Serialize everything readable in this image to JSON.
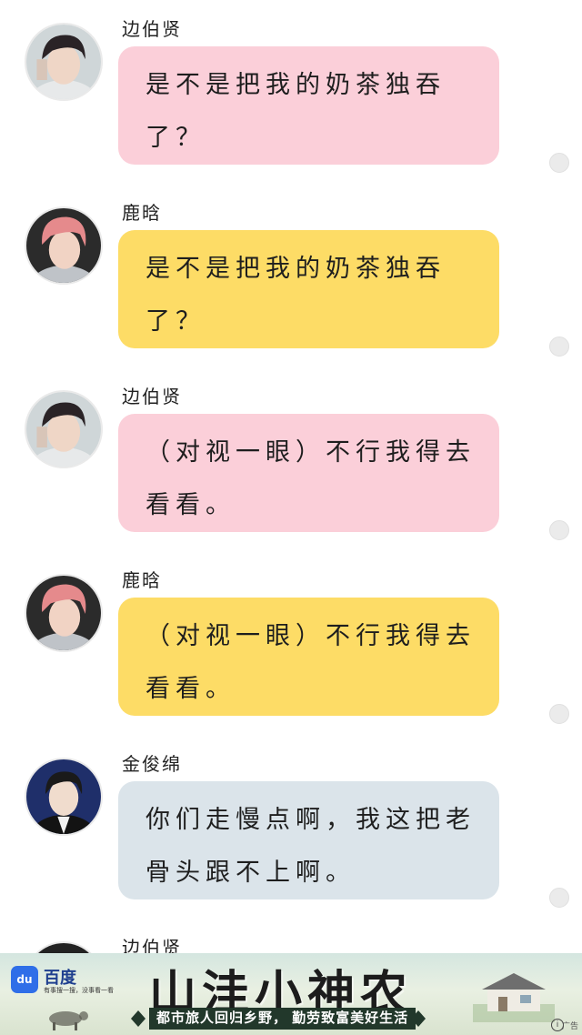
{
  "messages": [
    {
      "sender": "边伯贤",
      "text": "是不是把我的奶茶独吞了？",
      "bubble_color": "#fbcfd9",
      "avatar": "boy-dark-hair-avatar"
    },
    {
      "sender": "鹿晗",
      "text": "是不是把我的奶茶独吞了？",
      "bubble_color": "#fddc66",
      "avatar": "boy-pink-hair-avatar"
    },
    {
      "sender": "边伯贤",
      "text": "（对视一眼）不行我得去看看。",
      "bubble_color": "#fbcfd9",
      "avatar": "boy-dark-hair-avatar"
    },
    {
      "sender": "鹿晗",
      "text": "（对视一眼）不行我得去看看。",
      "bubble_color": "#fddc66",
      "avatar": "boy-pink-hair-avatar"
    },
    {
      "sender": "金俊绵",
      "text": "你们走慢点啊，我这把老骨头跟不上啊。",
      "bubble_color": "#dbe4ea",
      "avatar": "boy-suit-avatar"
    },
    {
      "sender": "边伯贤",
      "text": "",
      "bubble_color": "#fbcfd9",
      "avatar": "boy-dark-hair-avatar"
    }
  ],
  "ad": {
    "brand_logo": "du",
    "brand": "百度",
    "slogan": "有事搜一搜，没事看一看",
    "title": "山洼小神农",
    "tagline": "都市旅人回归乡野， 勤劳致富美好生活",
    "label": "广告",
    "info_icon": "i"
  }
}
